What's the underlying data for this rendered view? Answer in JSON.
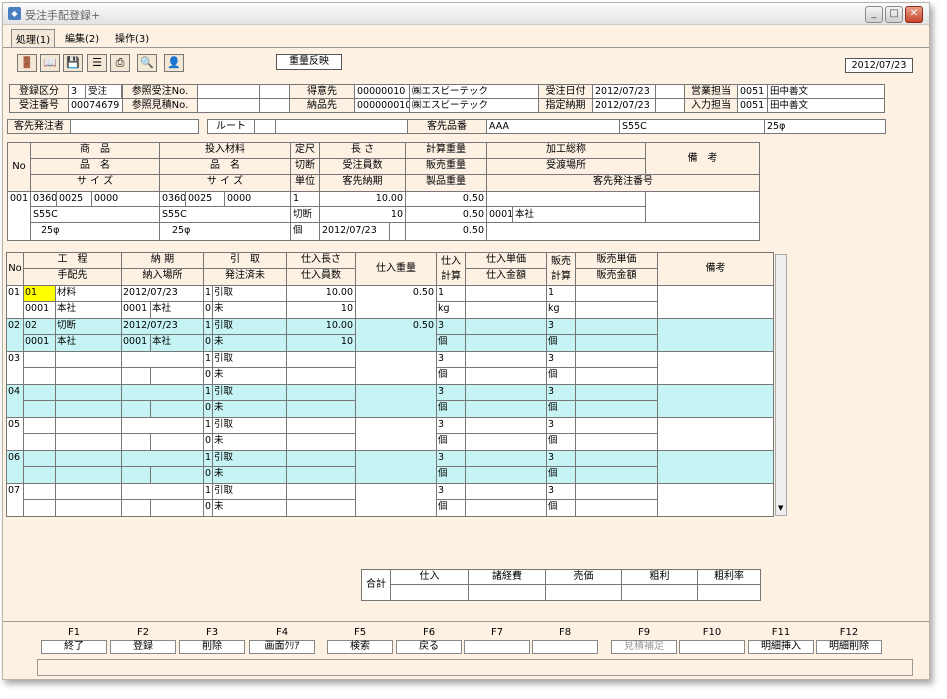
{
  "window": {
    "title": "受注手配登録+",
    "icon": "app-icon"
  },
  "menu": [
    "処理(1)",
    "編集(2)",
    "操作(3)"
  ],
  "toolbar": {
    "icons": [
      "exit-door-icon",
      "book-icon",
      "save-icon",
      "list-icon",
      "print-icon",
      "search-icon",
      "user-icon"
    ],
    "reflect_btn": "重量反映",
    "date": "2012/07/23"
  },
  "header": {
    "r1": {
      "l1": "登録区分",
      "v1a": "3",
      "v1b": "受注",
      "l2": "参照受注No.",
      "l3": "得意先",
      "v3a": "00000010",
      "v3b": "㈱エスビーテック",
      "l4": "受注日付",
      "v4": "2012/07/23",
      "l5": "営業担当",
      "v5a": "0051",
      "v5b": "田中善文"
    },
    "r2": {
      "l1": "受注番号",
      "v1": "00074679",
      "l2": "参照見積No.",
      "l3": "納品先",
      "v3a": "000000010",
      "v3b": "㈱エスビーテック",
      "l4": "指定納期",
      "v4": "2012/07/23",
      "l5": "入力担当",
      "v5a": "0051",
      "v5b": "田中善文"
    },
    "r3": {
      "l1": "客先発注者",
      "l2": "ルート",
      "l3": "客先品番",
      "v3": "AAA",
      "v4": "S55C",
      "v5": "25φ"
    }
  },
  "product": {
    "h": {
      "no": "No",
      "shohin": "商　品",
      "hinmei": "品　名",
      "size": "サ イ ズ",
      "tonyu": "投入材料",
      "hinmei2": "品　名",
      "size2": "サ イ ズ",
      "teishaku": "定尺",
      "setsudan": "切断",
      "tani": "単位",
      "nagasa": "長 さ",
      "kosuu": "受注員数",
      "nouki": "客先納期",
      "keisan": "計算重量",
      "hanbai": "販売重量",
      "seihin": "製品重量",
      "kakou": "加工総称",
      "ukewatashi": "受渡場所",
      "kyakusaki": "客先発注番号",
      "biko": "備　考"
    },
    "row": {
      "no": "001",
      "c1": "0360",
      "c2": "0025",
      "c3": "0000",
      "m1": "0360",
      "m2": "0025",
      "m3": "0000",
      "mat": "S55C",
      "mat2": "S55C",
      "sz": "25φ",
      "sz2": "25φ",
      "t1": "1",
      "t2": "切断",
      "t3": "個",
      "len": "10.00",
      "qty": "10",
      "date": "2012/07/23",
      "w1": "0.50",
      "w2": "0.50",
      "w3": "0.50",
      "place_code": "0001",
      "place": "本社"
    }
  },
  "grid": {
    "h": {
      "no": "No",
      "kotei": "工　程",
      "tehaisaki": "手配先",
      "nouki": "納 期",
      "nounyu": "納入場所",
      "hiki": "引　取",
      "hacchu": "発注済未",
      "nagasa": "仕入長さ",
      "kosuu": "仕入員数",
      "juryo": "仕入重量",
      "shiire_keisan": "仕入計算",
      "tanka": "仕入単価",
      "kingaku": "仕入金額",
      "hanbai_keisan": "販売計算",
      "htanka": "販売単価",
      "hkingaku": "販売金額",
      "biko": "備考"
    },
    "rows": [
      {
        "no": "01",
        "code": "01",
        "name": "材料",
        "date": "2012/07/23",
        "h1": "1",
        "h2": "引取",
        "len": "10.00",
        "w": "0.50",
        "sk": "1",
        "hk": "1",
        "sup": "0001",
        "supn": "本社",
        "pc": "0001",
        "pn": "本社",
        "s1": "0",
        "s2": "未",
        "qty": "10",
        "u1": "kg",
        "u2": "kg"
      },
      {
        "no": "02",
        "code": "02",
        "name": "切断",
        "date": "2012/07/23",
        "h1": "1",
        "h2": "引取",
        "len": "10.00",
        "w": "0.50",
        "sk": "3",
        "hk": "3",
        "sup": "0001",
        "supn": "本社",
        "pc": "0001",
        "pn": "本社",
        "s1": "0",
        "s2": "未",
        "qty": "10",
        "u1": "個",
        "u2": "個"
      },
      {
        "no": "03",
        "code": "",
        "name": "",
        "date": "",
        "h1": "1",
        "h2": "引取",
        "len": "",
        "w": "",
        "sk": "3",
        "hk": "3",
        "sup": "",
        "supn": "",
        "pc": "",
        "pn": "",
        "s1": "0",
        "s2": "未",
        "qty": "",
        "u1": "個",
        "u2": "個"
      },
      {
        "no": "04",
        "code": "",
        "name": "",
        "date": "",
        "h1": "1",
        "h2": "引取",
        "len": "",
        "w": "",
        "sk": "3",
        "hk": "3",
        "sup": "",
        "supn": "",
        "pc": "",
        "pn": "",
        "s1": "0",
        "s2": "未",
        "qty": "",
        "u1": "個",
        "u2": "個"
      },
      {
        "no": "05",
        "code": "",
        "name": "",
        "date": "",
        "h1": "1",
        "h2": "引取",
        "len": "",
        "w": "",
        "sk": "3",
        "hk": "3",
        "sup": "",
        "supn": "",
        "pc": "",
        "pn": "",
        "s1": "0",
        "s2": "未",
        "qty": "",
        "u1": "個",
        "u2": "個"
      },
      {
        "no": "06",
        "code": "",
        "name": "",
        "date": "",
        "h1": "1",
        "h2": "引取",
        "len": "",
        "w": "",
        "sk": "3",
        "hk": "3",
        "sup": "",
        "supn": "",
        "pc": "",
        "pn": "",
        "s1": "0",
        "s2": "未",
        "qty": "",
        "u1": "個",
        "u2": "個"
      },
      {
        "no": "07",
        "code": "",
        "name": "",
        "date": "",
        "h1": "1",
        "h2": "引取",
        "len": "",
        "w": "",
        "sk": "3",
        "hk": "3",
        "sup": "",
        "supn": "",
        "pc": "",
        "pn": "",
        "s1": "0",
        "s2": "未",
        "qty": "",
        "u1": "個",
        "u2": "個"
      }
    ]
  },
  "totals": {
    "label": "合計",
    "cols": [
      "仕入",
      "諸経費",
      "売価",
      "粗利",
      "粗利率"
    ]
  },
  "fkeys": [
    {
      "k": "F1",
      "l": "終了"
    },
    {
      "k": "F2",
      "l": "登録"
    },
    {
      "k": "F3",
      "l": "削除"
    },
    {
      "k": "F4",
      "l": "画面ｸﾘｱ"
    },
    {
      "k": "F5",
      "l": "検索"
    },
    {
      "k": "F6",
      "l": "戻る"
    },
    {
      "k": "F7",
      "l": ""
    },
    {
      "k": "F8",
      "l": ""
    },
    {
      "k": "F9",
      "l": "見積補足"
    },
    {
      "k": "F10",
      "l": ""
    },
    {
      "k": "F11",
      "l": "明細挿入"
    },
    {
      "k": "F12",
      "l": "明細削除"
    }
  ]
}
